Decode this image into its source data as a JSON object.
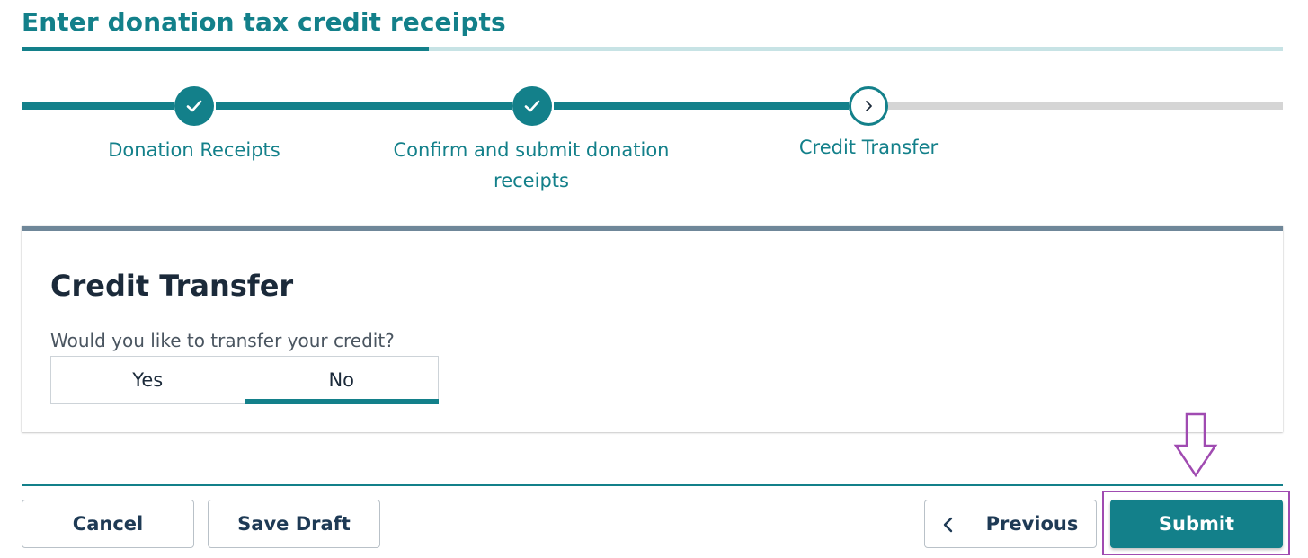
{
  "page": {
    "title": "Enter donation tax credit receipts"
  },
  "stepper": {
    "steps": [
      {
        "label": "Donation Receipts",
        "status": "completed",
        "icon": "check-icon"
      },
      {
        "label": "Confirm and submit donation receipts",
        "status": "completed",
        "icon": "check-icon"
      },
      {
        "label": "Credit Transfer",
        "status": "current",
        "icon": "chevron-right-icon"
      }
    ]
  },
  "card": {
    "title": "Credit Transfer",
    "question": "Would you like to transfer your credit?",
    "options": [
      {
        "label": "Yes",
        "selected": false
      },
      {
        "label": "No",
        "selected": true
      }
    ]
  },
  "footer": {
    "cancel_label": "Cancel",
    "save_draft_label": "Save Draft",
    "previous_label": "Previous",
    "submit_label": "Submit"
  },
  "annotation": {
    "arrow_icon": "down-arrow-icon",
    "highlight_target": "submit-button",
    "color": "#a04bb1"
  },
  "colors": {
    "accent": "#13808a",
    "accent_light": "#c7e3e5",
    "inactive_track": "#d5d5d5",
    "card_top_border": "#6f8799",
    "heading_text": "#1b2a3a",
    "button_text": "#1e3a55"
  }
}
